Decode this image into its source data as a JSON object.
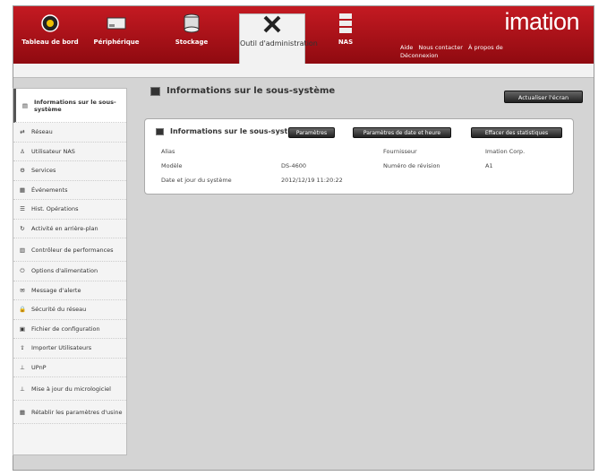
{
  "brand": "imation",
  "nav": [
    {
      "label": "Tableau de bord",
      "icon": "dashboard-icon"
    },
    {
      "label": "Périphérique",
      "icon": "device-icon"
    },
    {
      "label": "Stockage",
      "icon": "storage-icon"
    },
    {
      "label": "Outil d'administration",
      "icon": "tools-icon"
    },
    {
      "label": "NAS",
      "icon": "nas-icon"
    }
  ],
  "toplinks": [
    "Aide",
    "Nous contacter",
    "À propos de",
    "Déconnexion"
  ],
  "sidebar": [
    {
      "label": "Informations sur le sous-système",
      "icon": "info-icon"
    },
    {
      "label": "Réseau",
      "icon": "network-icon"
    },
    {
      "label": "Utilisateur NAS",
      "icon": "user-icon"
    },
    {
      "label": "Services",
      "icon": "services-icon"
    },
    {
      "label": "Événements",
      "icon": "events-icon"
    },
    {
      "label": "Hist. Opérations",
      "icon": "history-icon"
    },
    {
      "label": "Activité en arrière-plan",
      "icon": "background-activity-icon"
    },
    {
      "label": "Contrôleur de performances",
      "icon": "performance-icon"
    },
    {
      "label": "Options d'alimentation",
      "icon": "power-icon"
    },
    {
      "label": "Message d'alerte",
      "icon": "alert-message-icon"
    },
    {
      "label": "Sécurité du réseau",
      "icon": "lock-icon"
    },
    {
      "label": "Fichier de configuration",
      "icon": "config-file-icon"
    },
    {
      "label": "Importer Utilisateurs",
      "icon": "import-users-icon"
    },
    {
      "label": "UPnP",
      "icon": "upnp-icon"
    },
    {
      "label": "Mise à jour du micrologiciel",
      "icon": "firmware-icon"
    },
    {
      "label": "Rétablir les paramètres d'usine",
      "icon": "factory-reset-icon"
    }
  ],
  "main": {
    "title": "Informations sur le sous-système",
    "refresh_label": "Actualiser l'écran"
  },
  "panel": {
    "title": "Informations sur le sous-systè",
    "buttons": [
      "Paramètres",
      "Paramètres de date et heure",
      "Effacer des statistiques"
    ],
    "left": [
      {
        "label": "Alias",
        "value": ""
      },
      {
        "label": "Modèle",
        "value": "DS-4600"
      },
      {
        "label": "Date et jour du système",
        "value": "2012/12/19 11:20:22"
      }
    ],
    "right": [
      {
        "label": "Fournisseur",
        "value": "Imation Corp."
      },
      {
        "label": "Numéro de révision",
        "value": "A1"
      }
    ]
  }
}
